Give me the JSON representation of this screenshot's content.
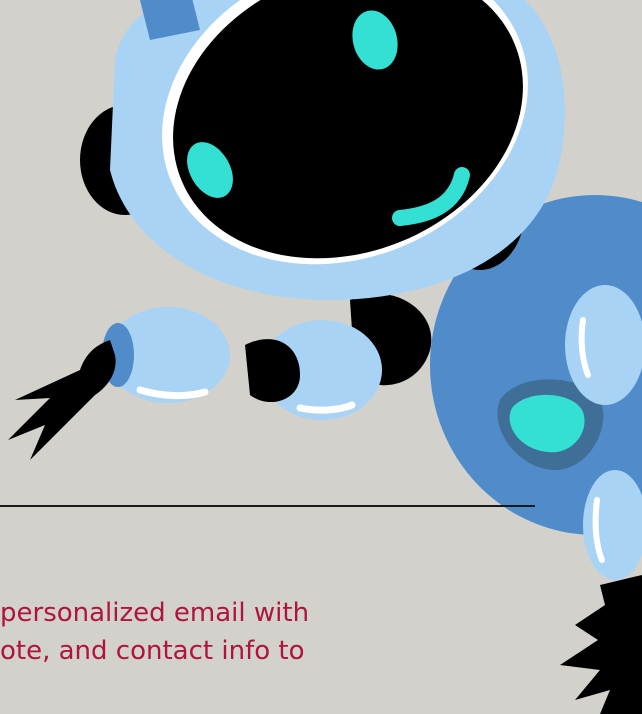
{
  "colors": {
    "background": "#d2d1cc",
    "robot_light": "#a9d3f4",
    "robot_mid": "#4f8cc9",
    "robot_dark": "#000000",
    "accent": "#34e0d3",
    "text": "#b0143c",
    "divider": "#1a1a1a"
  },
  "illustration": {
    "icon": "robot-icon"
  },
  "body": {
    "line1": " personalized email with",
    "line2": "ote, and contact info to"
  }
}
